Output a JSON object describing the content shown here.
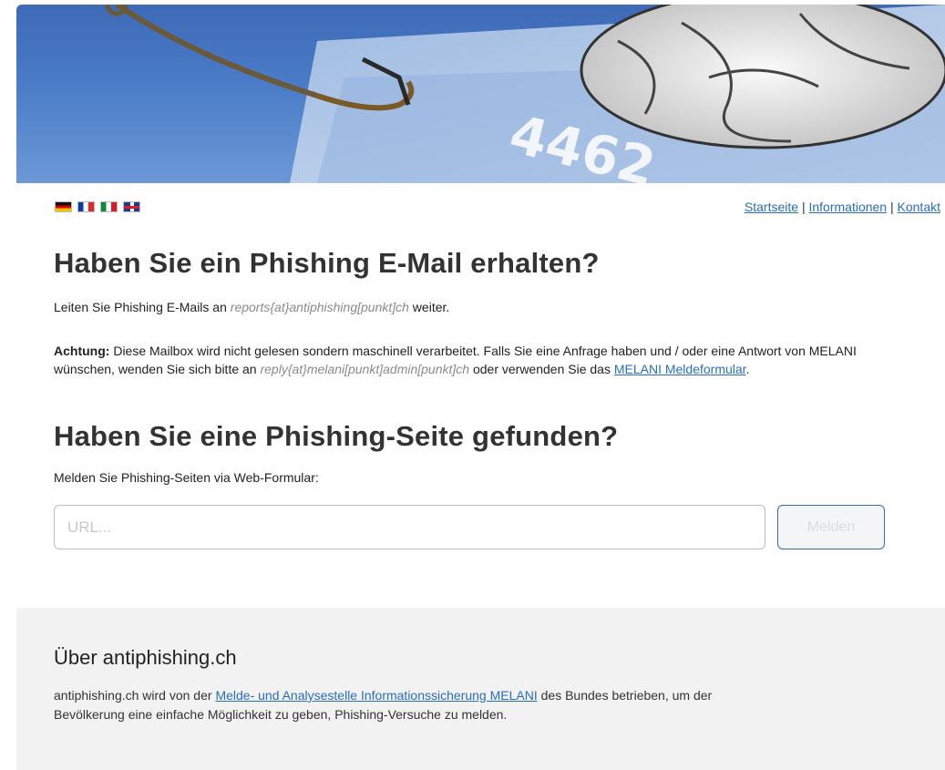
{
  "flags": [
    {
      "name": "de-flag-icon",
      "lang": "de"
    },
    {
      "name": "fr-flag-icon",
      "lang": "fr"
    },
    {
      "name": "it-flag-icon",
      "lang": "it"
    },
    {
      "name": "uk-flag-icon",
      "lang": "en"
    }
  ],
  "nav": {
    "home": "Startseite",
    "sep1": " | ",
    "info": "Informationen",
    "sep2": " | ",
    "contact": "Kontakt"
  },
  "email_section": {
    "title": "Haben Sie ein Phishing E-Mail erhalten?",
    "forward_prefix": "Leiten Sie Phishing E-Mails an ",
    "forward_address": "reports{at}antiphishing[punkt]ch",
    "forward_suffix": " weiter.",
    "warning_label": "Achtung:",
    "warning_text": " Diese Mailbox wird nicht gelesen sondern maschinell verarbeitet. Falls Sie eine Anfrage haben und / oder eine Antwort von MELANI wünschen, wenden Sie sich bitte an ",
    "reply_address": "reply{at}melani[punkt]admin[punkt]ch",
    "warning_mid": " oder verwenden Sie das ",
    "form_link": "MELANI Meldeformular",
    "warning_end": "."
  },
  "site_section": {
    "title": "Haben Sie eine Phishing-Seite gefunden?",
    "instruction": "Melden Sie Phishing-Seiten via Web-Formular:",
    "url_placeholder": "URL...",
    "url_value": "",
    "submit_label": "Melden"
  },
  "footer": {
    "title": "Über antiphishing.ch",
    "text_prefix": "antiphishing.ch wird von der ",
    "org_link": "Melde- und Analysestelle Informationssicherung MELANI",
    "text_suffix": " des Bundes betrieben, um der Bevölkerung eine einfache Möglichkeit zu geben, Phishing-Versuche zu melden."
  },
  "colors": {
    "link": "#2a6ebb",
    "heading": "#333333",
    "footer_bg": "#f2f2f2",
    "button_border": "#3a6aa8"
  }
}
